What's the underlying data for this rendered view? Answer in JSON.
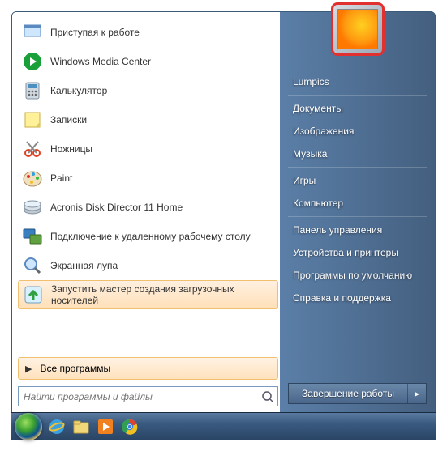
{
  "programs": [
    {
      "label": "Приступая к работе",
      "icon": "getting-started"
    },
    {
      "label": "Windows Media Center",
      "icon": "media-center"
    },
    {
      "label": "Калькулятор",
      "icon": "calculator"
    },
    {
      "label": "Записки",
      "icon": "sticky-notes"
    },
    {
      "label": "Ножницы",
      "icon": "snipping"
    },
    {
      "label": "Paint",
      "icon": "paint"
    },
    {
      "label": "Acronis Disk Director 11 Home",
      "icon": "acronis"
    },
    {
      "label": "Подключение к удаленному рабочему столу",
      "icon": "remote-desktop"
    },
    {
      "label": "Экранная лупа",
      "icon": "magnifier"
    },
    {
      "label": "Запустить мастер создания загрузочных носителей",
      "icon": "boot-media",
      "hl": true
    }
  ],
  "all_programs": "Все программы",
  "search_placeholder": "Найти программы и файлы",
  "right": {
    "user": "Lumpics",
    "items1": [
      "Документы",
      "Изображения",
      "Музыка"
    ],
    "items2": [
      "Игры",
      "Компьютер"
    ],
    "items3": [
      "Панель управления",
      "Устройства и принтеры",
      "Программы по умолчанию",
      "Справка и поддержка"
    ]
  },
  "shutdown": "Завершение работы"
}
